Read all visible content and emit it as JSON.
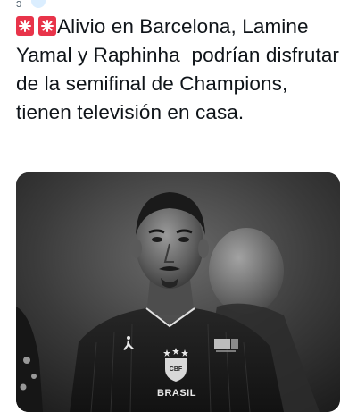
{
  "tweet": {
    "text": "Alivio en Barcelona, Lamine Yamal y Raphinha  podrían disfrutar de la semifinal de Champions, tienen televisión en casa.",
    "leading_icons": [
      "siren-icon",
      "siren-icon"
    ],
    "reply_glyph": "ↄ"
  },
  "media": {
    "kind": "photo",
    "style": "black-and-white",
    "jersey_text": "BRASIL",
    "crest_text": "CBF"
  },
  "colors": {
    "text": "#0f1419",
    "muted": "#536471",
    "siren_red": "#e8344a",
    "avatar_blue": "#dbeeff"
  }
}
